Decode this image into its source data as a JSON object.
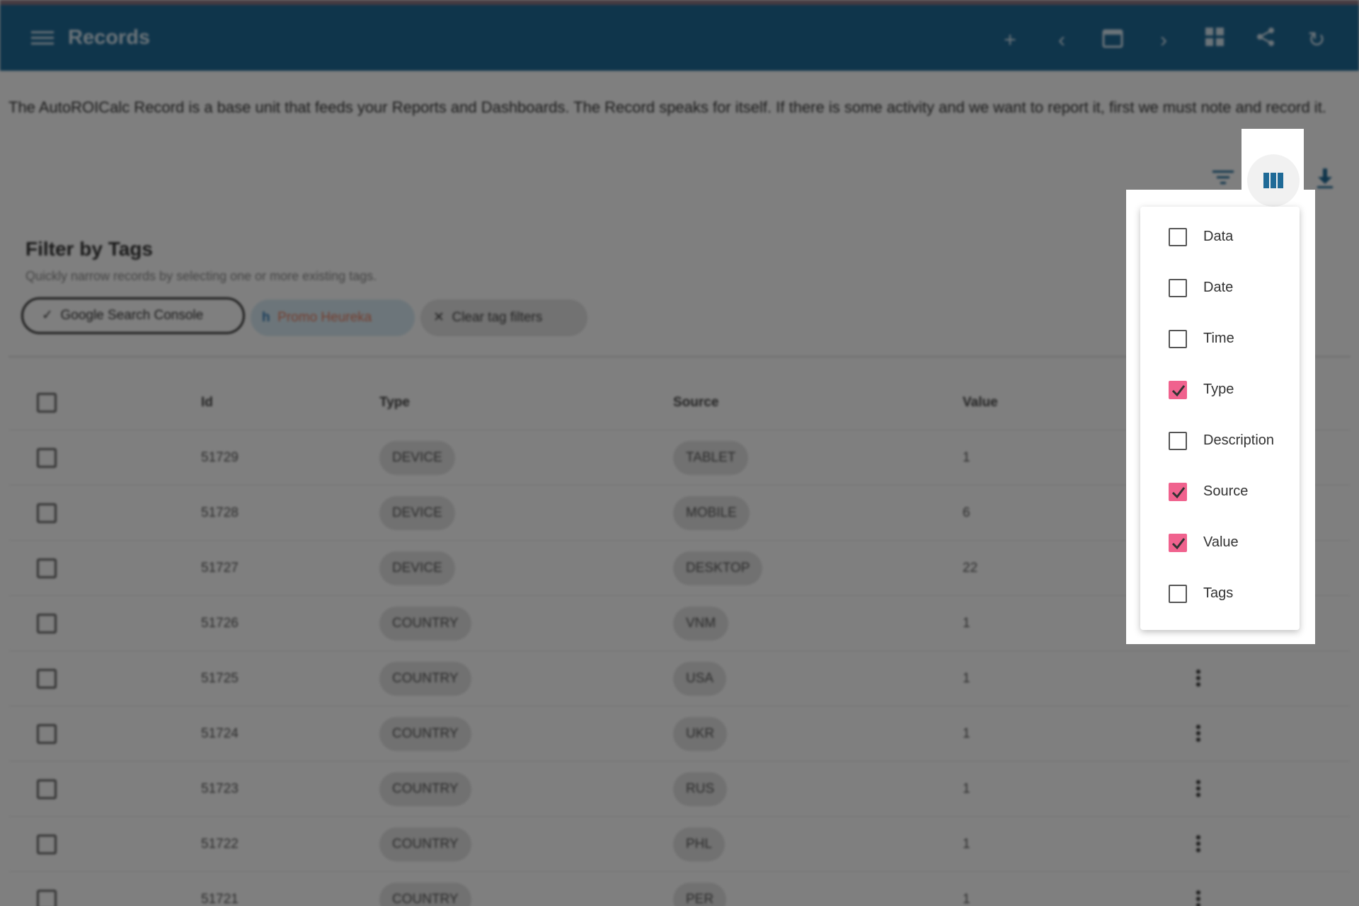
{
  "appbar": {
    "title": "Records",
    "icons": [
      "menu-icon",
      "add-icon",
      "chevron-left-icon",
      "calendar-icon",
      "chevron-right-icon",
      "dashboard-icon",
      "share-icon",
      "refresh-icon"
    ]
  },
  "intro_text": "The AutoROICalc Record is a base unit that feeds your Reports and Dashboards. The Record speaks for itself. If there is some activity and we want to report it, first we must note and record it.",
  "toolbar_icons": [
    "filter-icon",
    "columns-icon",
    "download-icon"
  ],
  "filter_card": {
    "title": "Filter by Tags",
    "subtitle": "Quickly narrow records by selecting one or more existing tags.",
    "chips": [
      {
        "label": "Google Search Console",
        "icon": "check-icon"
      },
      {
        "label": "Promo Heureka",
        "icon": "heureka-logo-icon"
      },
      {
        "label": "Clear tag filters",
        "icon": "close-icon"
      }
    ]
  },
  "table": {
    "headers": [
      "Id",
      "Type",
      "Source",
      "Value"
    ],
    "rows": [
      {
        "id": "51729",
        "type": "DEVICE",
        "source": "TABLET",
        "value": "1"
      },
      {
        "id": "51728",
        "type": "DEVICE",
        "source": "MOBILE",
        "value": "6"
      },
      {
        "id": "51727",
        "type": "DEVICE",
        "source": "DESKTOP",
        "value": "22"
      },
      {
        "id": "51726",
        "type": "COUNTRY",
        "source": "vnm",
        "value": "1"
      },
      {
        "id": "51725",
        "type": "COUNTRY",
        "source": "usa",
        "value": "1"
      },
      {
        "id": "51724",
        "type": "COUNTRY",
        "source": "ukr",
        "value": "1"
      },
      {
        "id": "51723",
        "type": "COUNTRY",
        "source": "rus",
        "value": "1"
      },
      {
        "id": "51722",
        "type": "COUNTRY",
        "source": "phl",
        "value": "1"
      },
      {
        "id": "51721",
        "type": "COUNTRY",
        "source": "per",
        "value": "1"
      }
    ]
  },
  "column_menu": {
    "items": [
      {
        "label": "Data",
        "checked": false
      },
      {
        "label": "Date",
        "checked": false
      },
      {
        "label": "Time",
        "checked": false
      },
      {
        "label": "Type",
        "checked": true
      },
      {
        "label": "Description",
        "checked": false
      },
      {
        "label": "Source",
        "checked": true
      },
      {
        "label": "Value",
        "checked": true
      },
      {
        "label": "Tags",
        "checked": false
      }
    ],
    "accent": "#f0628e"
  }
}
